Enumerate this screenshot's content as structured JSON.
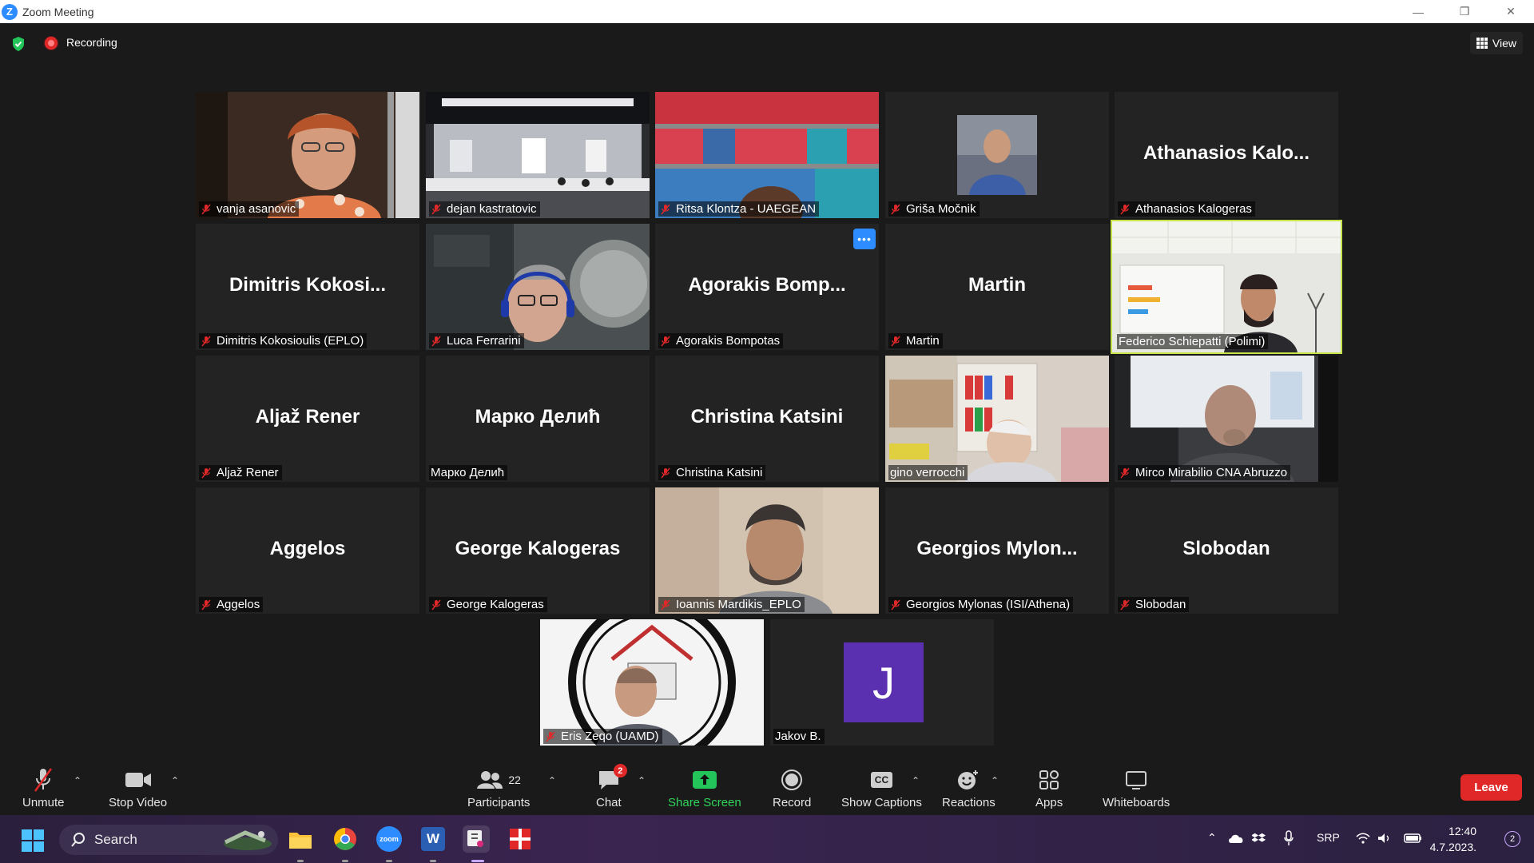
{
  "window": {
    "title": "Zoom Meeting",
    "controls": [
      "minimize",
      "restore",
      "close"
    ]
  },
  "topbar": {
    "recording_label": "Recording",
    "view_label": "View"
  },
  "participants": [
    {
      "display": "vanja asanovic",
      "big": "",
      "muted": true,
      "video": true
    },
    {
      "display": "dejan kastratovic",
      "big": "",
      "muted": true,
      "video": true
    },
    {
      "display": "Ritsa Klontza - UAEGEAN",
      "big": "",
      "muted": true,
      "video": true
    },
    {
      "display": "Griša Močnik",
      "big": "",
      "muted": true,
      "video": true
    },
    {
      "display": "Athanasios Kalogeras",
      "big": "Athanasios  Kalo...",
      "muted": true,
      "video": false
    },
    {
      "display": "Dimitris Kokosioulis (EPLO)",
      "big": "Dimitris  Kokosi...",
      "muted": true,
      "video": false
    },
    {
      "display": "Luca Ferrarini",
      "big": "",
      "muted": true,
      "video": true
    },
    {
      "display": "Agorakis Bompotas",
      "big": "Agorakis  Bomp...",
      "muted": true,
      "video": false
    },
    {
      "display": "Martin",
      "big": "Martin",
      "muted": true,
      "video": false
    },
    {
      "display": "Federico Schiepatti (Polimi)",
      "big": "",
      "muted": false,
      "video": true,
      "active_speaker": true
    },
    {
      "display": "Aljaž Rener",
      "big": "Aljaž Rener",
      "muted": true,
      "video": false
    },
    {
      "display": "Марко Делић",
      "big": "Марко Делић",
      "muted": false,
      "video": false
    },
    {
      "display": "Christina Katsini",
      "big": "Christina Katsini",
      "muted": true,
      "video": false
    },
    {
      "display": "gino verrocchi",
      "big": "",
      "muted": false,
      "video": true
    },
    {
      "display": "Mirco Mirabilio CNA Abruzzo",
      "big": "",
      "muted": true,
      "video": true
    },
    {
      "display": "Aggelos",
      "big": "Aggelos",
      "muted": true,
      "video": false
    },
    {
      "display": "George Kalogeras",
      "big": "George Kalogeras",
      "muted": true,
      "video": false
    },
    {
      "display": "Ioannis Mardikis_EPLO",
      "big": "",
      "muted": true,
      "video": true
    },
    {
      "display": "Georgios Mylonas (ISI/Athena)",
      "big": "Georgios  Mylon...",
      "muted": true,
      "video": false
    },
    {
      "display": "Slobodan",
      "big": "Slobodan",
      "muted": true,
      "video": false
    },
    {
      "display": "Eris Zeqo (UAMD)",
      "big": "",
      "muted": true,
      "video": true
    },
    {
      "display": "Jakov B.",
      "big": "",
      "muted": false,
      "video": false,
      "avatar_letter": "J"
    }
  ],
  "toolbar": {
    "unmute": "Unmute",
    "stop_video": "Stop Video",
    "participants": "Participants",
    "participants_count": "22",
    "chat": "Chat",
    "chat_badge": "2",
    "share_screen": "Share Screen",
    "record": "Record",
    "show_captions": "Show Captions",
    "captions_icon_text": "CC",
    "reactions": "Reactions",
    "apps": "Apps",
    "whiteboards": "Whiteboards",
    "leave": "Leave"
  },
  "taskbar": {
    "search": "Search",
    "zoom_icon_text": "zoom",
    "word_icon_text": "W",
    "language": "SRP",
    "time": "12:40",
    "date": "4.7.2023.",
    "notifications": "2"
  },
  "colors": {
    "active_speaker": "#c7e34a",
    "share_green": "#2fd45a",
    "leave_red": "#e02828",
    "accent": "#2d8cff"
  }
}
